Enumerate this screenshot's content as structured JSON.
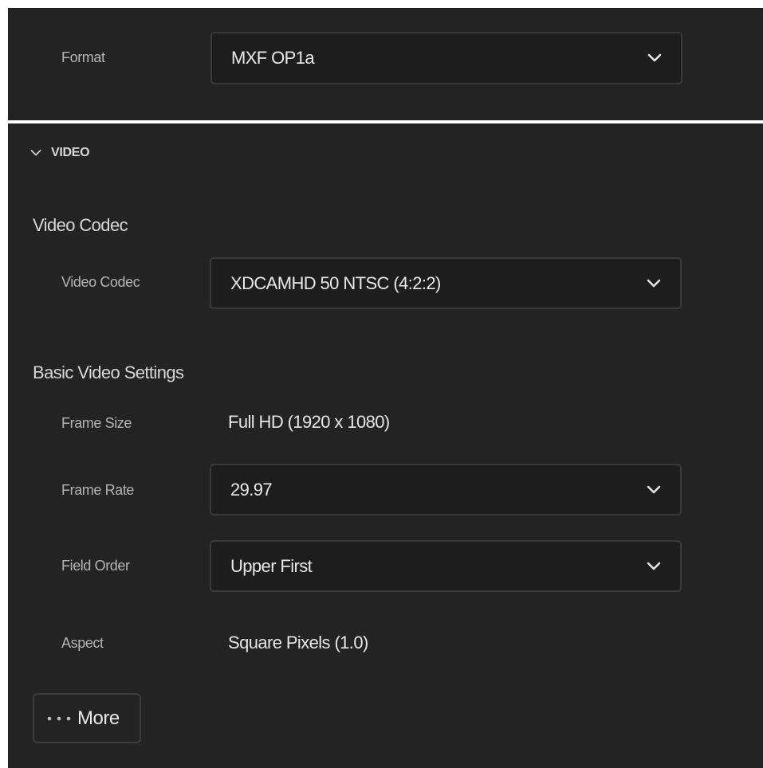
{
  "format": {
    "label": "Format",
    "value": "MXF OP1a"
  },
  "video_section": {
    "title": "VIDEO",
    "codec_group": {
      "heading": "Video Codec",
      "codec_label": "Video Codec",
      "codec_value": "XDCAMHD 50 NTSC (4:2:2)"
    },
    "basic_settings": {
      "heading": "Basic Video Settings",
      "frame_size_label": "Frame Size",
      "frame_size_value": "Full HD (1920 x 1080)",
      "frame_rate_label": "Frame Rate",
      "frame_rate_value": "29.97",
      "field_order_label": "Field Order",
      "field_order_value": "Upper First",
      "aspect_label": "Aspect",
      "aspect_value": "Square Pixels (1.0)"
    },
    "more_button": {
      "label": "More",
      "icon": "ellipsis-icon"
    }
  },
  "icons": {
    "dropdown": "chevron-down-icon",
    "section_toggle": "chevron-down-icon"
  },
  "colors": {
    "panel_bg": "#232323",
    "field_bg": "#1d1d1d",
    "field_border": "#3a3a3a",
    "text_primary": "#e8e8e8",
    "text_label": "#b4b4b4"
  }
}
